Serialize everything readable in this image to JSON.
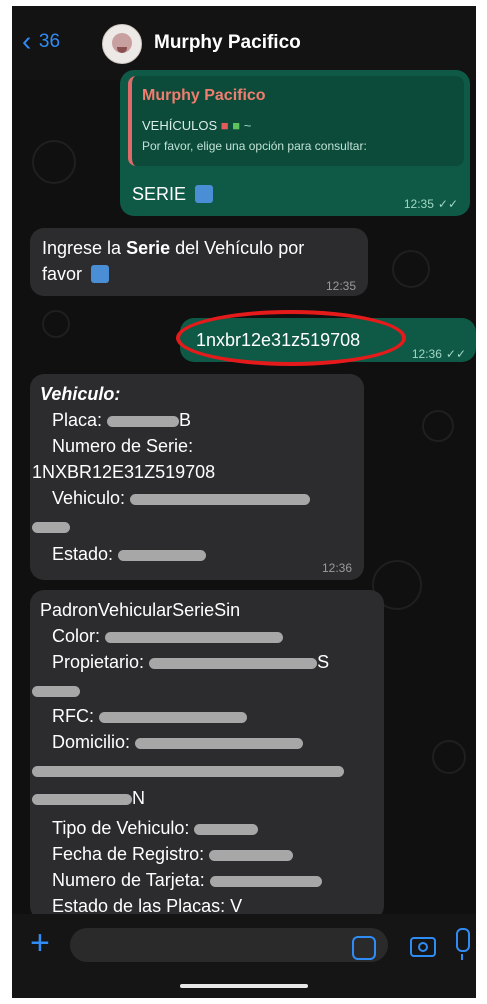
{
  "header": {
    "back_count": "36",
    "contact_name": "Murphy Pacifico"
  },
  "messages": [
    {
      "type": "outgoing",
      "quote": {
        "name": "Murphy Pacifico",
        "line1": "VEHÍCULOS",
        "line2": "Por favor, elige una opción para consultar:"
      },
      "text": "SERIE",
      "time": "12:35"
    },
    {
      "type": "incoming",
      "text_before": "Ingrese la ",
      "text_bold": "Serie",
      "text_after": " del Vehículo por",
      "text_line2": "favor",
      "time": "12:35"
    },
    {
      "type": "outgoing",
      "text": "1nxbr12e31z519708",
      "time": "12:36"
    },
    {
      "type": "incoming",
      "title": "Vehiculo:",
      "placa_label": "Placa:",
      "placa_suffix": "B",
      "serie_label": "Numero de Serie:",
      "serie_value": "1NXBR12E31Z519708",
      "vehiculo_label": "Vehiculo:",
      "estado_label": "Estado:",
      "time": "12:36"
    },
    {
      "type": "incoming",
      "title": "PadronVehicularSerieSin",
      "color_label": "Color:",
      "propietario_label": "Propietario:",
      "propietario_suffix": "S",
      "rfc_label": "RFC:",
      "domicilio_label": "Domicilio:",
      "domicilio_suffix": "N",
      "tipo_label": "Tipo de Vehiculo:",
      "fecha_label": "Fecha de Registro:",
      "tarjeta_label": "Numero de Tarjeta:",
      "estado_placas_label": "Estado de las Placas:",
      "estado_placas_value": "V"
    }
  ]
}
